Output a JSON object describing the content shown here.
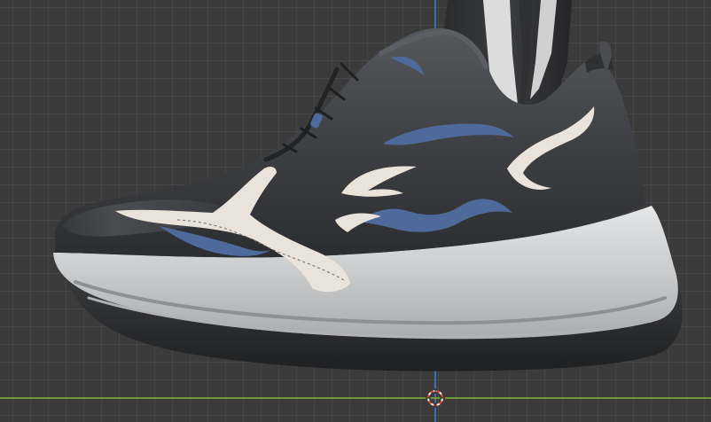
{
  "viewport": {
    "background": "#3b3b3b",
    "grid_color": "#4a4a4a",
    "axis_x_color": "#6f9a32",
    "axis_z_color": "#3f6fb0"
  },
  "model": {
    "upper_color": "#3d3f42",
    "sole_color": "#d4d6d8",
    "outsole_color": "#2b2c2e",
    "accent_white": "#e9e3dc",
    "accent_blue": "#4e6a9a"
  },
  "cursor": {
    "icon": "3d-cursor-icon",
    "ring_color_a": "#e0452f",
    "ring_color_b": "#f2f2f2"
  }
}
